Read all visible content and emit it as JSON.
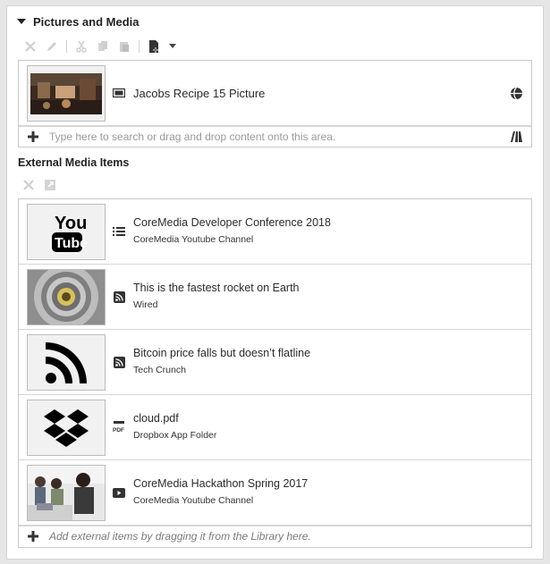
{
  "pictures": {
    "header": "Pictures and Media",
    "item": {
      "title": "Jacobs Recipe 15 Picture"
    },
    "placeholder": "Type here to search or drag and drop content onto this area."
  },
  "external": {
    "header": "External Media Items",
    "items": [
      {
        "title": "CoreMedia Developer Conference 2018",
        "source": "CoreMedia Youtube Channel",
        "type_icon": "list-icon",
        "thumb": "youtube-logo"
      },
      {
        "title": "This is the fastest rocket on Earth",
        "source": "Wired",
        "type_icon": "rss-icon",
        "thumb": "rocket-photo"
      },
      {
        "title": "Bitcoin price falls but doesn’t flatline",
        "source": "Tech Crunch",
        "type_icon": "rss-icon",
        "thumb": "rss-logo"
      },
      {
        "title": "cloud.pdf",
        "source": "Dropbox App Folder",
        "type_icon": "pdf-icon",
        "thumb": "dropbox-logo"
      },
      {
        "title": "CoreMedia Hackathon Spring 2017",
        "source": "CoreMedia Youtube Channel",
        "type_icon": "play-icon",
        "thumb": "hackathon-photo"
      }
    ],
    "add_hint": "Add external items by dragging it from the Library here."
  }
}
